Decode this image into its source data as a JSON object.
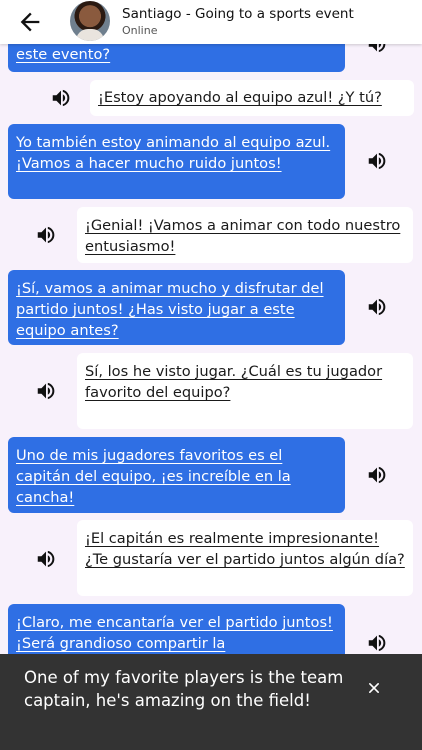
{
  "header": {
    "title": "Santiago - Going to a sports event",
    "status": "Online"
  },
  "messages": [
    {
      "role": "user",
      "text": "este evento?"
    },
    {
      "role": "bot",
      "text": "¡Estoy apoyando al equipo azul! ¿Y tú?"
    },
    {
      "role": "user",
      "text": "Yo también estoy animando al equipo azul. ¡Vamos a hacer mucho ruido juntos!"
    },
    {
      "role": "bot",
      "text": "¡Genial! ¡Vamos a animar con todo nuestro entusiasmo!"
    },
    {
      "role": "user",
      "text": "¡Sí, vamos a animar mucho y disfrutar del partido juntos! ¿Has visto jugar a este equipo antes?"
    },
    {
      "role": "bot",
      "text": "Sí, los he visto jugar. ¿Cuál es tu jugador favorito del equipo?"
    },
    {
      "role": "user",
      "text": "Uno de mis jugadores favoritos es el capitán del equipo, ¡es increíble en la cancha!"
    },
    {
      "role": "bot",
      "text": "¡El capitán es realmente impresionante! ¿Te gustaría ver el partido juntos algún día?"
    },
    {
      "role": "user",
      "text": "¡Claro, me encantaría ver el partido juntos! ¡Será grandioso compartir la"
    }
  ],
  "toast": {
    "text": "One of my favorite players is the team captain, he's amazing on the field!"
  },
  "icons": {
    "back": "arrow-left-icon",
    "speaker": "volume-up-icon",
    "close": "close-icon"
  },
  "colors": {
    "user_bubble": "#2f6fe4",
    "bot_bubble": "#ffffff",
    "background": "#f8f1fb",
    "toast": "#333333"
  }
}
